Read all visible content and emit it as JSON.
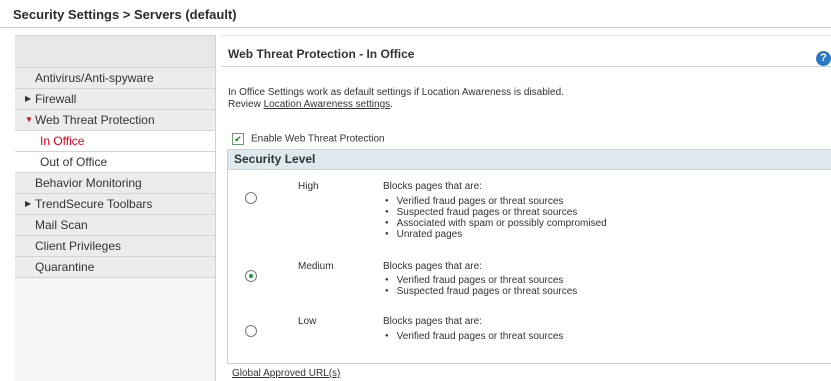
{
  "header": {
    "breadcrumb": "Security Settings > Servers (default)"
  },
  "sidebar": {
    "items": [
      {
        "label": "Antivirus/Anti-spyware"
      },
      {
        "label": "Firewall",
        "arrow": "▶"
      },
      {
        "label": "Web Threat Protection",
        "arrow": "▼"
      },
      {
        "label": "In Office"
      },
      {
        "label": "Out of Office"
      },
      {
        "label": "Behavior Monitoring"
      },
      {
        "label": "TrendSecure Toolbars",
        "arrow": "▶"
      },
      {
        "label": "Mail Scan"
      },
      {
        "label": "Client Privileges"
      },
      {
        "label": "Quarantine"
      }
    ]
  },
  "main": {
    "title": "Web Threat Protection - In Office",
    "help_glyph": "?",
    "desc_line1": "In Office Settings work as default settings if Location Awareness is disabled.",
    "desc_review": "Review",
    "desc_link": "Location Awareness settings",
    "desc_end": ".",
    "enable_label": "Enable Web Threat Protection",
    "enable_checked": true,
    "security_level_title": "Security Level",
    "levels": [
      {
        "name": "High",
        "selected": false,
        "intro": "Blocks pages that are:",
        "bullets": [
          "Verified fraud pages or threat sources",
          "Suspected fraud pages or threat sources",
          "Associated with spam or possibly compromised",
          "Unrated pages"
        ]
      },
      {
        "name": "Medium",
        "selected": true,
        "intro": "Blocks pages that are:",
        "bullets": [
          "Verified fraud pages or threat sources",
          "Suspected fraud pages or threat sources"
        ]
      },
      {
        "name": "Low",
        "selected": false,
        "intro": "Blocks pages that are:",
        "bullets": [
          "Verified fraud pages or threat sources"
        ]
      }
    ],
    "approved_link": "Global Approved URL(s)"
  },
  "colors": {
    "active": "#e0001a",
    "section_header": "#dde9ec",
    "help": "#2a7ac9"
  }
}
